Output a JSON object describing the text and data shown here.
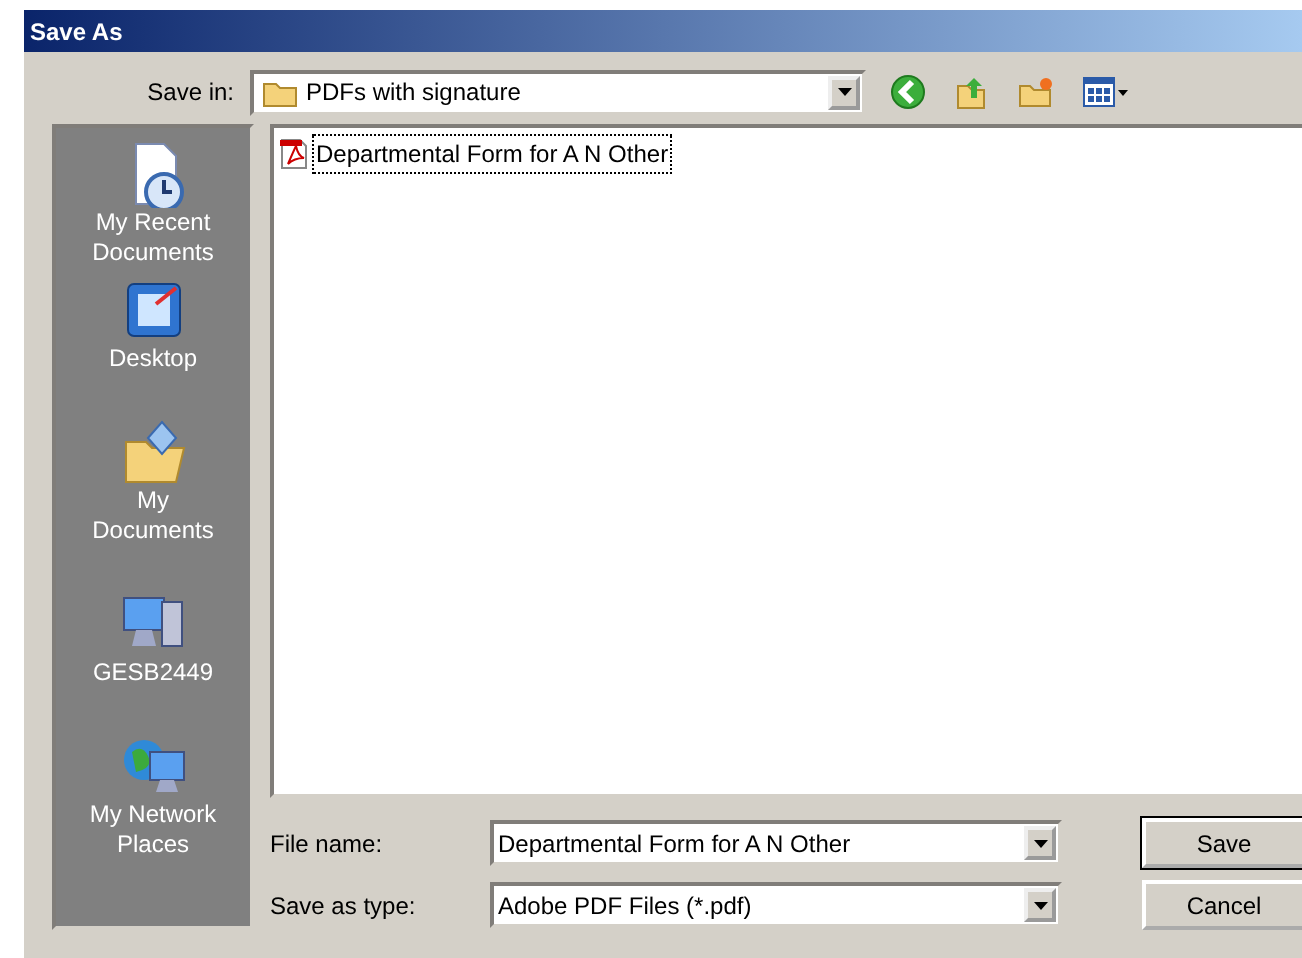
{
  "window": {
    "title": "Save As"
  },
  "save_in": {
    "label": "Save in:",
    "value": "PDFs with signature"
  },
  "toolbar": [
    {
      "kind": "back"
    },
    {
      "kind": "up"
    },
    {
      "kind": "new-folder"
    },
    {
      "kind": "views"
    }
  ],
  "places": [
    {
      "kind": "recent",
      "label": "My Recent Documents",
      "selected": false
    },
    {
      "kind": "desktop",
      "label": "Desktop",
      "selected": false
    },
    {
      "kind": "documents",
      "label": "My Documents",
      "selected": false
    },
    {
      "kind": "computer",
      "label": "GESB2449",
      "selected": false
    },
    {
      "kind": "network",
      "label": "My Network Places",
      "selected": false
    }
  ],
  "files": [
    {
      "name": "Departmental Form for A N Other",
      "focused": true,
      "selected": false
    }
  ],
  "file_name": {
    "label": "File name:",
    "value": "Departmental Form for A N Other"
  },
  "save_as_type": {
    "label": "Save as type:",
    "value": "Adobe PDF Files (*.pdf)"
  },
  "buttons": [
    "Save",
    "Cancel"
  ]
}
